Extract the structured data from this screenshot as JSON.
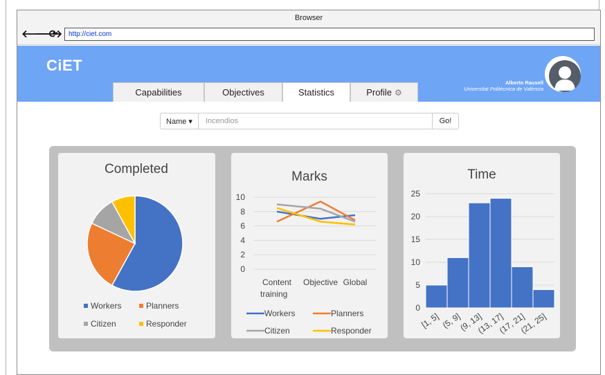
{
  "browser": {
    "title": "Browser",
    "url": "http://ciet.com"
  },
  "nav": {
    "back": "🡐",
    "forward": "🡒",
    "reload": "⟳"
  },
  "app": {
    "logo": "CiET"
  },
  "tabs": [
    {
      "label": "Capabilities"
    },
    {
      "label": "Objectives"
    },
    {
      "label": "Statistics"
    },
    {
      "label": "Profile"
    }
  ],
  "user": {
    "name": "Alberto Rausell",
    "affiliation": "Universitat Politècnica de València"
  },
  "search": {
    "select_label": "Name ▾",
    "query": "Incendios",
    "go_label": "Go!"
  },
  "colors": {
    "header": "#6fa5f5",
    "blue": "#4472c4",
    "orange": "#ed7d31",
    "gray": "#a5a5a5",
    "yellow": "#ffc000"
  },
  "chart_data": [
    {
      "type": "pie",
      "title": "Completed",
      "categories": [
        "Workers",
        "Planners",
        "Citizen",
        "Responder"
      ],
      "values": [
        58,
        24,
        10,
        8
      ],
      "colors": [
        "#4472c4",
        "#ed7d31",
        "#a5a5a5",
        "#ffc000"
      ],
      "legend": "bottom"
    },
    {
      "type": "line",
      "title": "Marks",
      "categories": [
        "Content training",
        "Objective",
        "Global"
      ],
      "tick_labels": [
        "Content",
        "Objective",
        "Global"
      ],
      "tick_sub": "training",
      "ylim": [
        0,
        10
      ],
      "yticks": [
        0,
        2,
        4,
        6,
        8,
        10
      ],
      "grid": true,
      "legend": "bottom",
      "series": [
        {
          "name": "Workers",
          "values": [
            8,
            7,
            7.5
          ],
          "color": "#4472c4"
        },
        {
          "name": "Planners",
          "values": [
            6.6,
            9.4,
            6.8
          ],
          "color": "#ed7d31"
        },
        {
          "name": "Citizen",
          "values": [
            9,
            8.4,
            6.6
          ],
          "color": "#a5a5a5"
        },
        {
          "name": "Responder",
          "values": [
            8.5,
            6.6,
            6.2
          ],
          "color": "#ffc000"
        }
      ]
    },
    {
      "type": "bar",
      "title": "Time",
      "categories": [
        "[1, 5]",
        "(5, 9]",
        "(9, 13]",
        "(13, 17]",
        "(17, 21]",
        "(21, 25]"
      ],
      "values": [
        5,
        11,
        23,
        24,
        9,
        4
      ],
      "ylim": [
        0,
        25
      ],
      "yticks": [
        0,
        5,
        10,
        15,
        20,
        25
      ],
      "grid": true,
      "color": "#4472c4"
    }
  ]
}
